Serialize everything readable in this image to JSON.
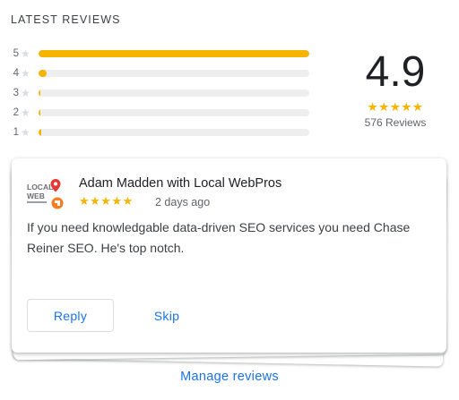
{
  "section": {
    "title": "LATEST REVIEWS"
  },
  "histogram": [
    {
      "stars": "5",
      "fraction": 1.0
    },
    {
      "stars": "4",
      "fraction": 0.03
    },
    {
      "stars": "3",
      "fraction": 0.005
    },
    {
      "stars": "2",
      "fraction": 0.005
    },
    {
      "stars": "1",
      "fraction": 0.01
    }
  ],
  "summary": {
    "rating": "4.9",
    "stars": "★★★★★",
    "count_label": "576 Reviews"
  },
  "review": {
    "reviewer": "Adam Madden with Local WebPros",
    "stars": "★★★★★",
    "rating": 5,
    "date": "2 days ago",
    "text": "If you need knowledgable data-driven SEO services you need Chase Reiner SEO. He's top notch.",
    "avatar_text_1": "LOCAL",
    "avatar_text_2": "WEB"
  },
  "actions": {
    "reply_label": "Reply",
    "skip_label": "Skip",
    "manage_label": "Manage reviews"
  },
  "colors": {
    "accent": "#1a73e8",
    "star": "#f6b300",
    "track": "#eeeeee"
  }
}
